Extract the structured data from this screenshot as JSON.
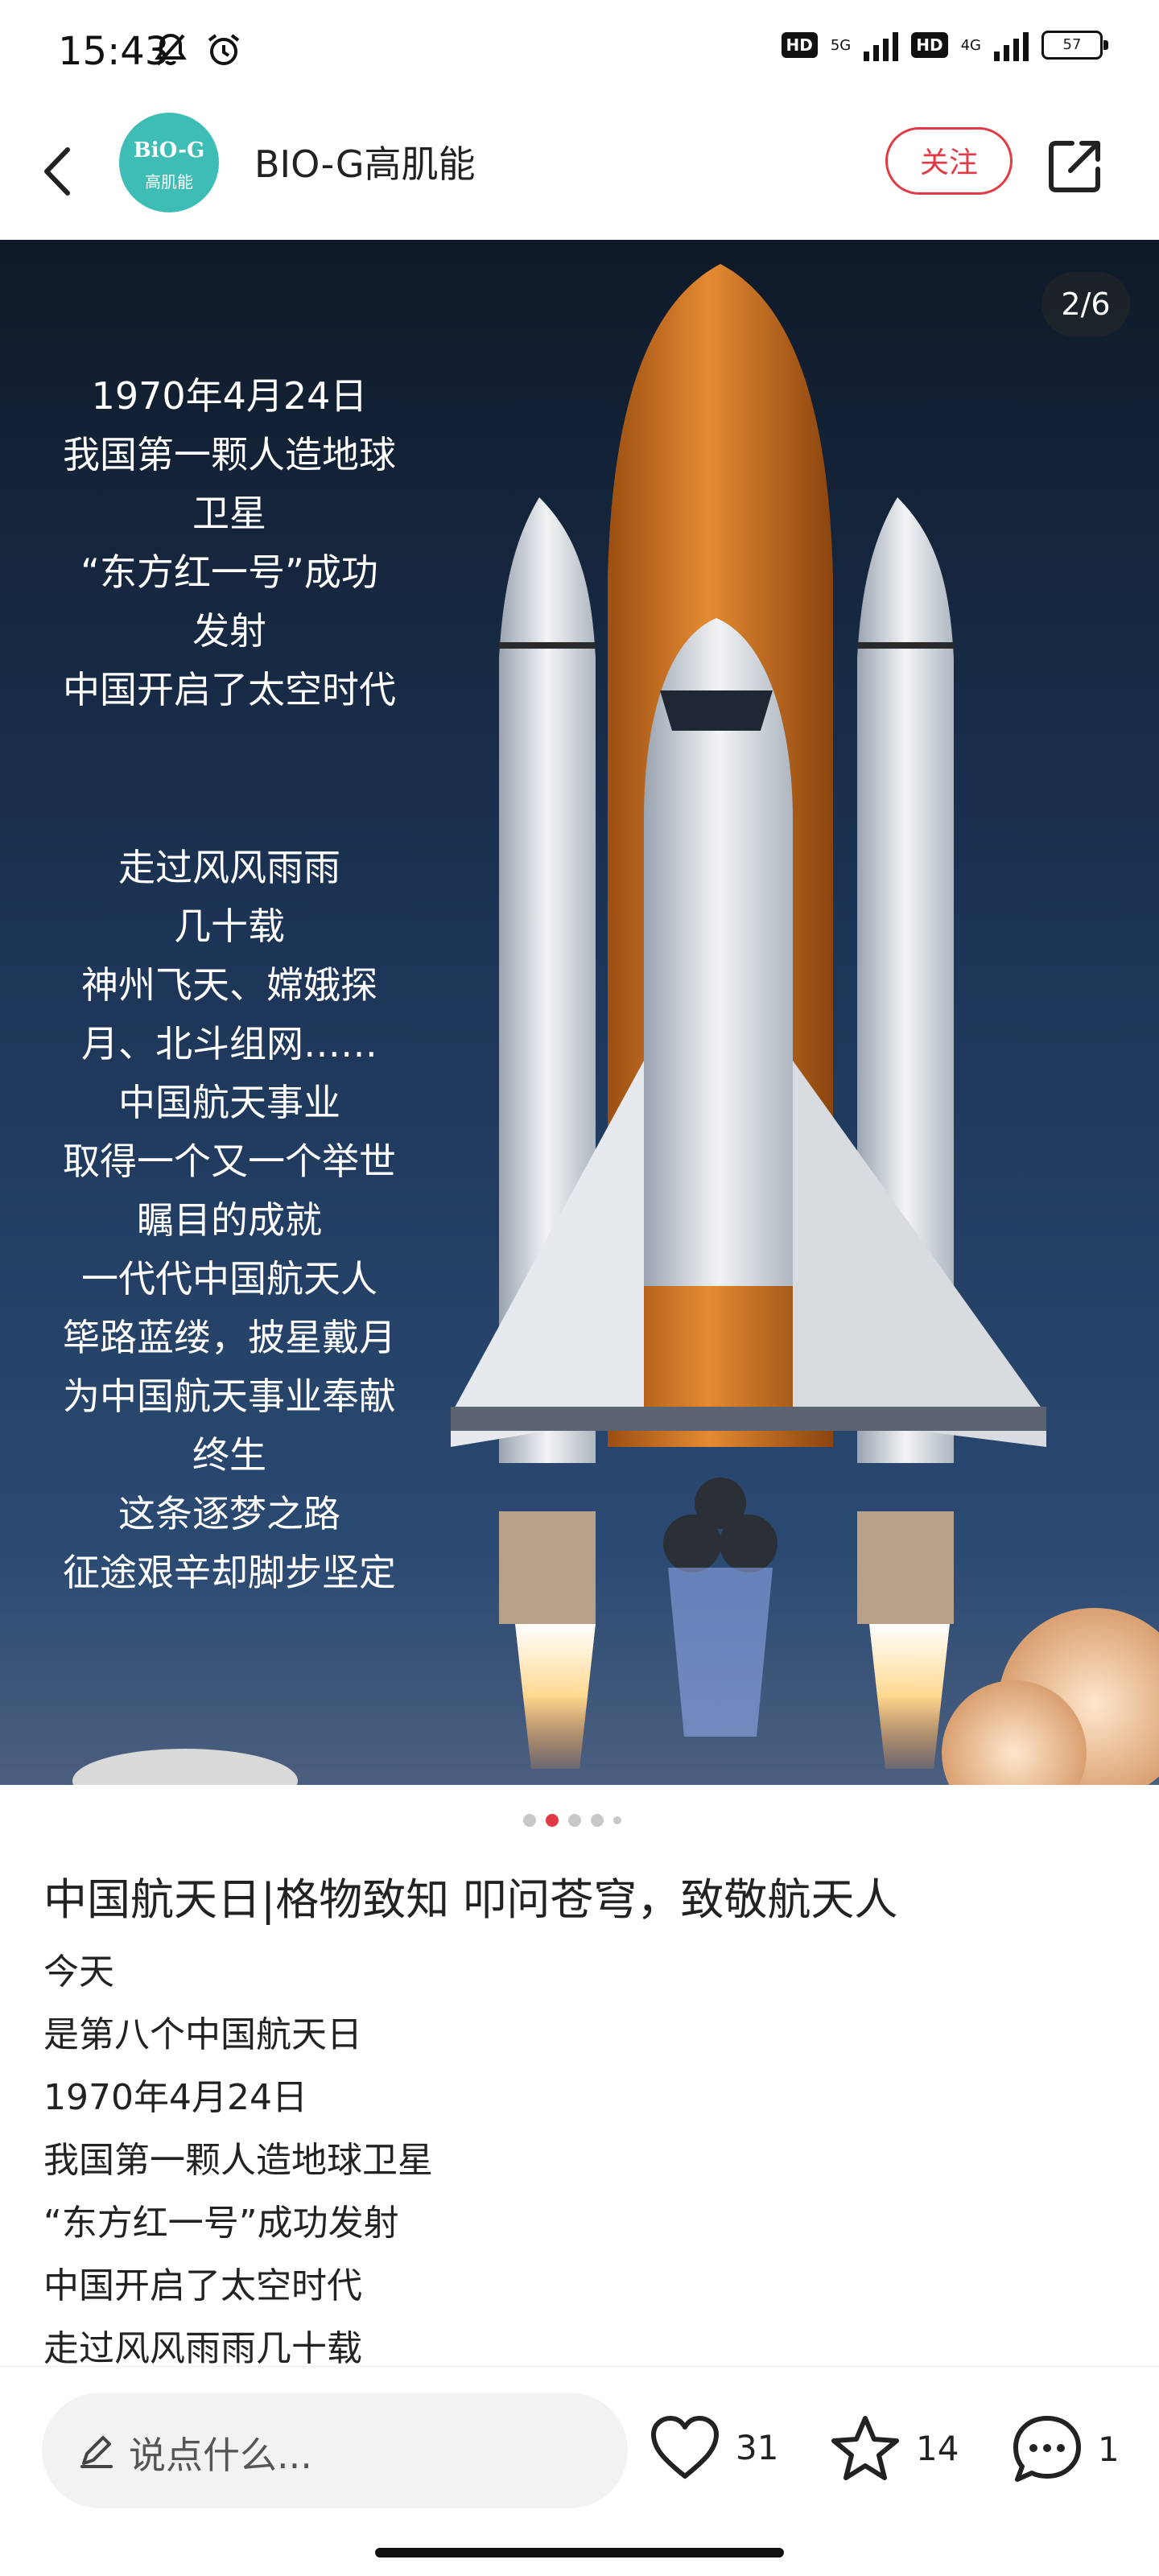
{
  "status_bar": {
    "time": "15:43",
    "network_1": "5G",
    "network_2": "4G",
    "hd_badge": "HD",
    "battery": "57",
    "icons": [
      "mute-bell-icon",
      "alarm-icon",
      "signal-icon",
      "battery-icon"
    ]
  },
  "header": {
    "avatar_text_line1": "BiO-G",
    "avatar_text_line2": "高肌能",
    "account_name": "BIO-G高肌能",
    "follow_label": "关注",
    "icons": [
      "back-arrow-icon",
      "share-icon"
    ]
  },
  "hero": {
    "page_indicator": "2/6",
    "overlay_lines_1": [
      "1970年4月24日",
      "我国第一颗人造地球",
      "卫星",
      "“东方红一号”成功",
      "发射",
      "中国开启了太空时代"
    ],
    "overlay_lines_2": [
      "走过风风雨雨",
      "几十载",
      "神州飞天、嫦娥探",
      "月、北斗组网……",
      "中国航天事业",
      "取得一个又一个举世",
      "瞩目的成就",
      "一代代中国航天人",
      "筚路蓝缕，披星戴月",
      "为中国航天事业奉献",
      "终生",
      "这条逐梦之路",
      "征途艰辛却脚步坚定"
    ],
    "carousel_total": 6,
    "carousel_active": 2
  },
  "post": {
    "title": "中国航天日|格物致知 叩问苍穹，致敬航天人",
    "body_lines": [
      "今天",
      "是第八个中国航天日",
      "1970年4月24日",
      "我国第一颗人造地球卫星",
      "“东方红一号”成功发射",
      "中国开启了太空时代",
      "走过风风雨雨几十载"
    ]
  },
  "bottom_bar": {
    "comment_placeholder": "说点什么...",
    "like_count": "31",
    "favorite_count": "14",
    "comment_count": "1",
    "accent_color": "#e23a45"
  }
}
